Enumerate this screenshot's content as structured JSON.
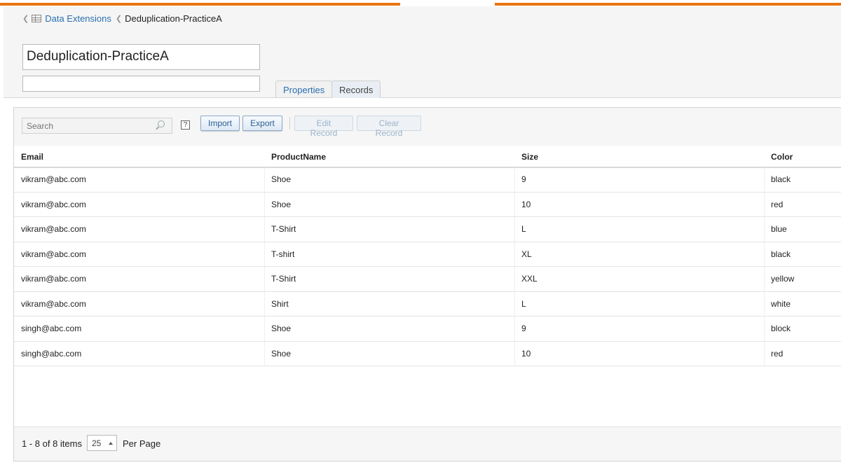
{
  "breadcrumb": {
    "parent": "Data Extensions",
    "current": "Deduplication-PracticeA"
  },
  "extension": {
    "name": "Deduplication-PracticeA",
    "description": ""
  },
  "tabs": [
    {
      "label": "Properties",
      "active": false
    },
    {
      "label": "Records",
      "active": true
    }
  ],
  "toolbar": {
    "search_placeholder": "Search",
    "help": "?",
    "import_label": "Import",
    "export_label": "Export",
    "edit_label": "Edit Record",
    "clear_label": "Clear Record"
  },
  "table": {
    "columns": [
      "Email",
      "ProductName",
      "Size",
      "Color"
    ],
    "rows": [
      [
        "vikram@abc.com",
        "Shoe",
        "9",
        "black"
      ],
      [
        "vikram@abc.com",
        "Shoe",
        "10",
        "red"
      ],
      [
        "vikram@abc.com",
        "T-Shirt",
        "L",
        "blue"
      ],
      [
        "vikram@abc.com",
        "T-shirt",
        "XL",
        "black"
      ],
      [
        "vikram@abc.com",
        "T-Shirt",
        "XXL",
        "yellow"
      ],
      [
        "vikram@abc.com",
        "Shirt",
        "L",
        "white"
      ],
      [
        "singh@abc.com",
        "Shoe",
        "9",
        "block"
      ],
      [
        "singh@abc.com",
        "Shoe",
        "10",
        "red"
      ]
    ]
  },
  "pager": {
    "range_text": "1 - 8 of 8 items",
    "page_size": "25",
    "per_page_label": "Per Page"
  },
  "colors": {
    "accent": "#e8740f",
    "link": "#2a6fb0"
  }
}
